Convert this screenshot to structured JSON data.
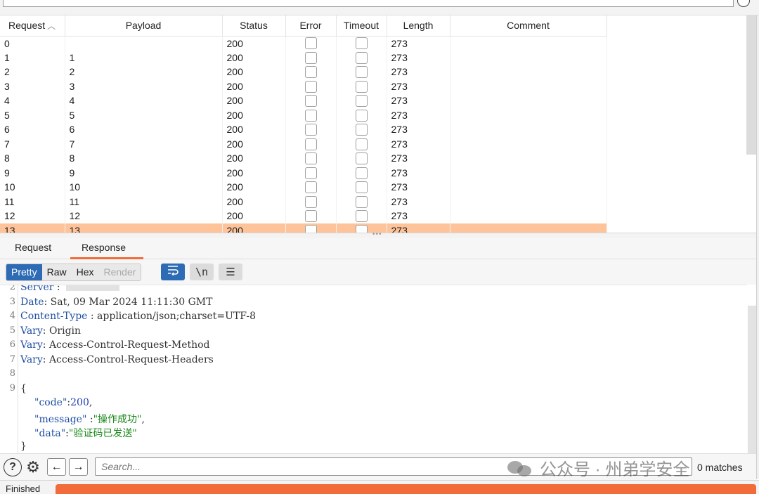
{
  "table": {
    "columns": [
      "Request",
      "Payload",
      "Status",
      "Error",
      "Timeout",
      "Length",
      "Comment"
    ],
    "rows": [
      {
        "request": "0",
        "payload": "",
        "status": "200",
        "length": "273"
      },
      {
        "request": "1",
        "payload": "1",
        "status": "200",
        "length": "273"
      },
      {
        "request": "2",
        "payload": "2",
        "status": "200",
        "length": "273"
      },
      {
        "request": "3",
        "payload": "3",
        "status": "200",
        "length": "273"
      },
      {
        "request": "4",
        "payload": "4",
        "status": "200",
        "length": "273"
      },
      {
        "request": "5",
        "payload": "5",
        "status": "200",
        "length": "273"
      },
      {
        "request": "6",
        "payload": "6",
        "status": "200",
        "length": "273"
      },
      {
        "request": "7",
        "payload": "7",
        "status": "200",
        "length": "273"
      },
      {
        "request": "8",
        "payload": "8",
        "status": "200",
        "length": "273"
      },
      {
        "request": "9",
        "payload": "9",
        "status": "200",
        "length": "273"
      },
      {
        "request": "10",
        "payload": "10",
        "status": "200",
        "length": "273"
      },
      {
        "request": "11",
        "payload": "11",
        "status": "200",
        "length": "273"
      },
      {
        "request": "12",
        "payload": "12",
        "status": "200",
        "length": "273"
      },
      {
        "request": "13",
        "payload": "13",
        "status": "200",
        "length": "273",
        "selected": true
      }
    ],
    "selected_row_color": "#ffc39a"
  },
  "tabs": {
    "request": "Request",
    "response": "Response",
    "active": "Response"
  },
  "toolbar": {
    "pretty": "Pretty",
    "raw": "Raw",
    "hex": "Hex",
    "render": "Render",
    "newline_label": "\\n"
  },
  "editor": {
    "lines": [
      {
        "n": "2",
        "key": "Server",
        "sep": " :",
        "value": ""
      },
      {
        "n": "3",
        "key": "Date",
        "sep": ":",
        "value": " Sat, 09 Mar 2024 11:11:30 GMT"
      },
      {
        "n": "4",
        "key": "Content-Type",
        "sep": " :",
        "value": " application/json;charset=UTF-8"
      },
      {
        "n": "5",
        "key": "Vary",
        "sep": ":",
        "value": " Origin"
      },
      {
        "n": "6",
        "key": "Vary",
        "sep": ":",
        "value": " Access-Control-Request-Method"
      },
      {
        "n": "7",
        "key": "Vary",
        "sep": ":",
        "value": " Access-Control-Request-Headers"
      },
      {
        "n": "8"
      },
      {
        "n": "9"
      }
    ],
    "json_open": "{",
    "json_close": "}",
    "json": [
      {
        "key": "\"code\"",
        "sep": ":",
        "value": "200",
        "kind": "num",
        "tail": ","
      },
      {
        "key": "\"message\"",
        "sep": " :",
        "value": "\"操作成功\"",
        "kind": "str",
        "tail": ","
      },
      {
        "key": "\"data\"",
        "sep": ":",
        "value": "\"验证码已发送\"",
        "kind": "str",
        "tail": ""
      }
    ]
  },
  "search": {
    "placeholder": "Search...",
    "matches": "0 matches"
  },
  "watermark": "公众号 · 州弟学安全",
  "status": {
    "text": "Finished",
    "progress": 1.0,
    "accent": "#f26b3a"
  }
}
